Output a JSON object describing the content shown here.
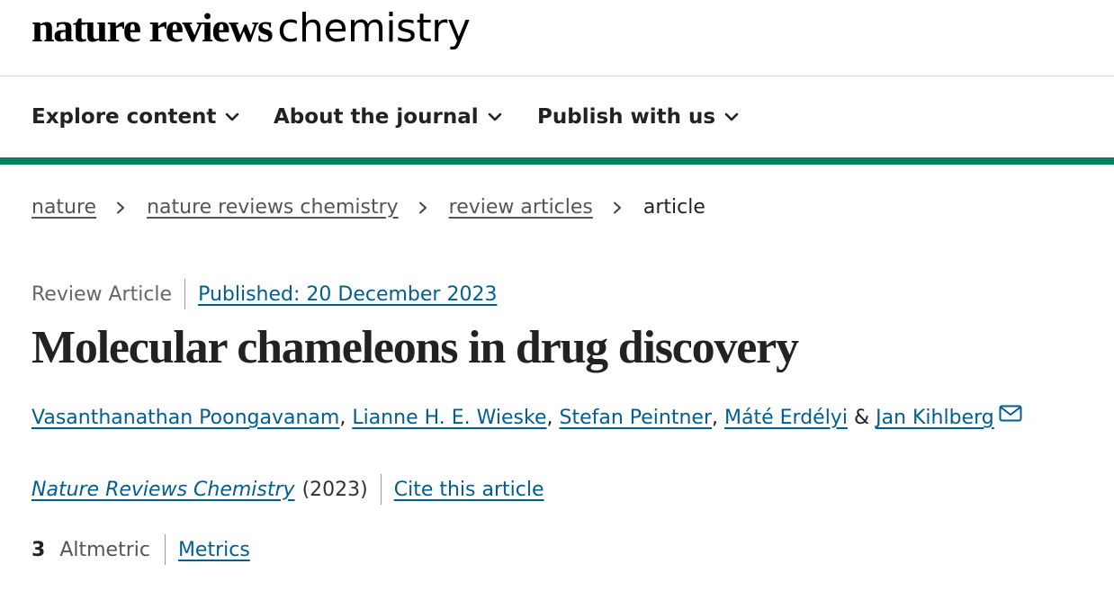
{
  "brand": {
    "logo_bold": "nature reviews",
    "logo_light": "chemistry"
  },
  "nav": {
    "items": [
      {
        "label": "Explore content",
        "icon": "chevron-down-icon"
      },
      {
        "label": "About the journal",
        "icon": "chevron-down-icon"
      },
      {
        "label": "Publish with us",
        "icon": "chevron-down-icon"
      }
    ],
    "accent_color": "#00845f"
  },
  "breadcrumb": {
    "items": [
      {
        "label": "nature"
      },
      {
        "label": "nature reviews chemistry"
      },
      {
        "label": "review articles"
      },
      {
        "label": "article"
      }
    ],
    "separator_icon": "chevron-right-icon"
  },
  "article": {
    "type": "Review Article",
    "published": "Published: 20 December 2023",
    "title": "Molecular chameleons in drug discovery",
    "authors": [
      "Vasanthanathan Poongavanam",
      "Lianne H. E. Wieske",
      "Stefan Peintner",
      "Máté Erdélyi",
      "Jan Kihlberg"
    ],
    "author_separator": ",",
    "author_final_joiner": "&",
    "corresponding_icon": "mail-icon",
    "journal": "Nature Reviews Chemistry",
    "year": "(2023)",
    "cite_label": "Cite this article",
    "altmetric_count": "3",
    "altmetric_label": "Altmetric",
    "metrics_label": "Metrics",
    "link_color": "#025e8d"
  }
}
